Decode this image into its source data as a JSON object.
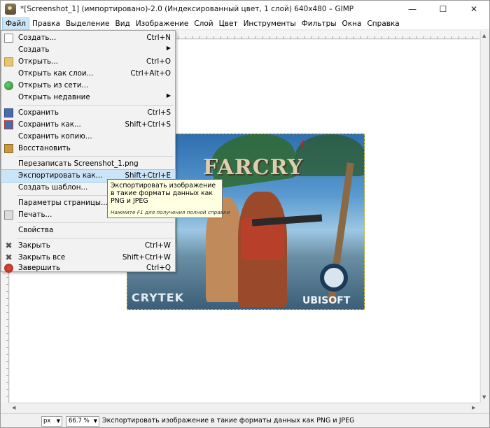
{
  "window": {
    "title": "*[Screenshot_1] (импортировано)-2.0 (Индексированный цвет, 1 слой) 640x480 – GIMP",
    "controls": {
      "minimize": "—",
      "maximize": "☐",
      "close": "✕"
    }
  },
  "menubar": [
    "Файл",
    "Правка",
    "Выделение",
    "Вид",
    "Изображение",
    "Слой",
    "Цвет",
    "Инструменты",
    "Фильтры",
    "Окна",
    "Справка"
  ],
  "file_menu": [
    {
      "label": "Создать...",
      "shortcut": "Ctrl+N",
      "icon": "new-icon"
    },
    {
      "label": "Создать",
      "shortcut": "",
      "submenu": true
    },
    {
      "label": "Открыть...",
      "shortcut": "Ctrl+O",
      "icon": "open-icon"
    },
    {
      "label": "Открыть как слои...",
      "shortcut": "Ctrl+Alt+O"
    },
    {
      "label": "Открыть из сети...",
      "shortcut": "",
      "icon": "web-icon"
    },
    {
      "label": "Открыть недавние",
      "shortcut": "",
      "submenu": true
    },
    {
      "label": "Сохранить",
      "shortcut": "Ctrl+S",
      "icon": "save-icon"
    },
    {
      "label": "Сохранить как...",
      "shortcut": "Shift+Ctrl+S",
      "icon": "save-as-icon"
    },
    {
      "label": "Сохранить копию...",
      "shortcut": ""
    },
    {
      "label": "Восстановить",
      "shortcut": "",
      "icon": "revert-icon"
    },
    {
      "label": "Перезаписать Screenshot_1.png",
      "shortcut": ""
    },
    {
      "label": "Экспортировать как...",
      "shortcut": "Shift+Ctrl+E"
    },
    {
      "label": "Создать шаблон...",
      "shortcut": ""
    },
    {
      "label": "Параметры страницы...",
      "shortcut": ""
    },
    {
      "label": "Печать...",
      "shortcut": "",
      "icon": "print-icon"
    },
    {
      "label": "Свойства",
      "shortcut": ""
    },
    {
      "label": "Закрыть",
      "shortcut": "Ctrl+W",
      "icon": "close-icon"
    },
    {
      "label": "Закрыть все",
      "shortcut": "Shift+Ctrl+W",
      "icon": "close-all-icon"
    },
    {
      "label": "Завершить",
      "shortcut": "Ctrl+Q",
      "icon": "quit-icon"
    }
  ],
  "tooltip": {
    "text": "Экспортировать изображение в такие форматы данных как PNG и JPEG",
    "hint": "Нажмите F1 для получения полной справки"
  },
  "canvas_image": {
    "game_title": "FARCRY",
    "corner_mark": "ǂ",
    "logo_left": "CRYTEK",
    "logo_right": "UBISOFT"
  },
  "statusbar": {
    "unit": "px",
    "zoom": "66.7 %",
    "message": "Экспортировать изображение в такие форматы данных как PNG и JPEG"
  },
  "colors": {
    "highlight": "#cce4f7",
    "tooltip_bg": "#ffffe1"
  }
}
